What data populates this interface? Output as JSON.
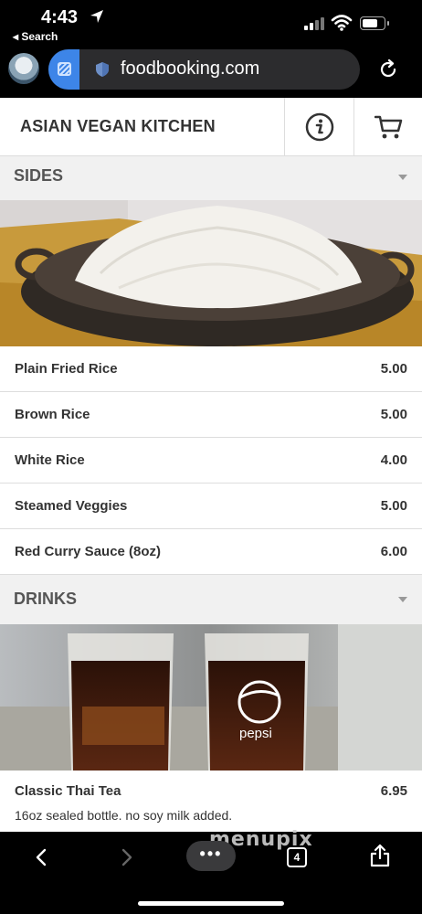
{
  "status_bar": {
    "time": "4:43",
    "back_app": "◂ Search"
  },
  "browser": {
    "url": "foodbooking.com",
    "tab_count": "4",
    "more_label": "•••"
  },
  "header": {
    "restaurant_name": "ASIAN VEGAN KITCHEN"
  },
  "sections": [
    {
      "title": "SIDES",
      "items": [
        {
          "name": "Plain Fried Rice",
          "price": "5.00"
        },
        {
          "name": "Brown Rice",
          "price": "5.00"
        },
        {
          "name": "White Rice",
          "price": "4.00"
        },
        {
          "name": "Steamed Veggies",
          "price": "5.00"
        },
        {
          "name": "Red Curry Sauce (8oz)",
          "price": "6.00"
        }
      ]
    },
    {
      "title": "DRINKS",
      "items": [
        {
          "name": "Classic Thai Tea",
          "price": "6.95",
          "description": "16oz sealed bottle. no soy milk added."
        }
      ]
    }
  ],
  "drink_image": {
    "logo_text": "pepsi"
  },
  "watermark": "menupix",
  "icons": [
    "location-arrow-icon",
    "signal-icon",
    "wifi-icon",
    "battery-icon",
    "shield-icon",
    "reload-icon",
    "info-icon",
    "cart-icon",
    "chevron-left-icon",
    "chevron-right-icon",
    "share-icon"
  ],
  "colors": {
    "url_tab_accent": "#3d85e8",
    "section_bg": "#f1f1f1"
  }
}
